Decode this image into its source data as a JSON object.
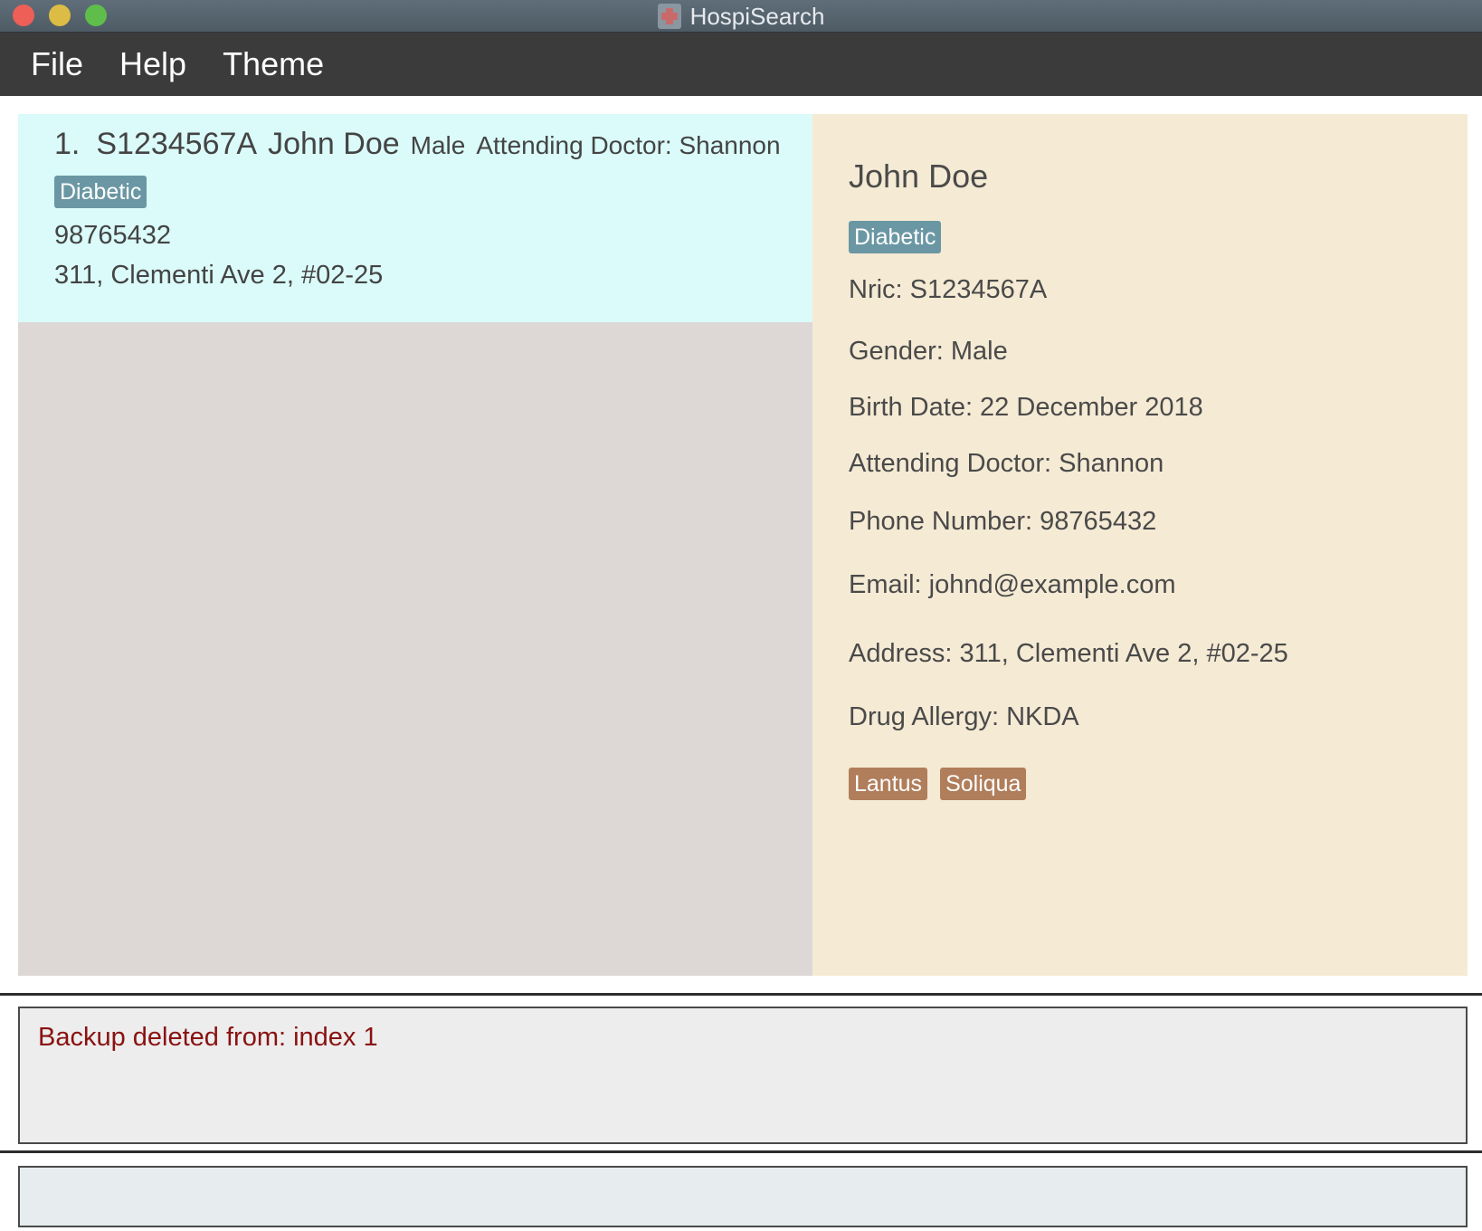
{
  "window": {
    "title": "HospiSearch"
  },
  "menu": {
    "items": [
      "File",
      "Help",
      "Theme"
    ]
  },
  "person_list": [
    {
      "index": "1.",
      "nric": "S1234567A",
      "name": "John Doe",
      "gender": "Male",
      "doctor": "Attending Doctor: Shannon",
      "tags": [
        "Diabetic"
      ],
      "phone": "98765432",
      "address": "311, Clementi Ave 2, #02-25"
    }
  ],
  "details": {
    "name": "John Doe",
    "tag": "Diabetic",
    "nric": "Nric: S1234567A",
    "gender": "Gender: Male",
    "birth_date": "Birth Date: 22 December 2018",
    "doctor": "Attending Doctor: Shannon",
    "phone": "Phone Number: 98765432",
    "email": "Email: johnd@example.com",
    "address": "Address: 311, Clementi Ave 2, #02-25",
    "drug_allergy": "Drug Allergy: NKDA",
    "drugs": [
      "Lantus",
      "Soliqua"
    ]
  },
  "result": {
    "message": "Backup deleted from: index 1"
  },
  "command": {
    "value": "",
    "placeholder": ""
  },
  "colors": {
    "card_selected": "#dafbf9",
    "list_bg": "#ddd8d5",
    "detail_bg": "#f5ead4",
    "tag_blue": "#6a97a3",
    "tag_brown": "#b07e5b",
    "result_text": "#8a1111"
  }
}
